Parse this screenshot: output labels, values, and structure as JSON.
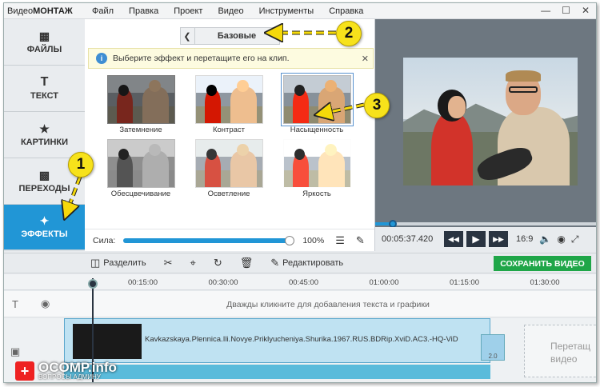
{
  "app": {
    "title_left": "Видео",
    "title_bold": "МОНТАЖ",
    "menu": [
      "Файл",
      "Правка",
      "Проект",
      "Видео",
      "Инструменты",
      "Справка"
    ]
  },
  "sidebar": {
    "items": [
      {
        "label": "ФАЙЛЫ",
        "icon": "image-icon"
      },
      {
        "label": "ТЕКСТ",
        "icon": "text-icon"
      },
      {
        "label": "КАРТИНКИ",
        "icon": "star-icon"
      },
      {
        "label": "ПЕРЕХОДЫ",
        "icon": "transition-icon"
      },
      {
        "label": "ЭФФЕКТЫ",
        "icon": "magic-wand-icon",
        "active": true
      }
    ]
  },
  "effects": {
    "category": "Базовые",
    "info_text": "Выберите эффект и перетащите его на клип.",
    "tiles": [
      {
        "label": "Затемнение",
        "style": "dark"
      },
      {
        "label": "Контраст",
        "style": "contrast"
      },
      {
        "label": "Насыщенность",
        "style": "saturation",
        "selected": true
      },
      {
        "label": "Обесцвечивание",
        "style": "gray"
      },
      {
        "label": "Осветление",
        "style": "light"
      },
      {
        "label": "Яркость",
        "style": "bright"
      }
    ],
    "power_label": "Сила:",
    "power_value": "100%",
    "power_fraction": 1.0
  },
  "player": {
    "time": "00:05:37.420",
    "aspect": "16:9",
    "progress_fraction": 0.08
  },
  "toolbar": {
    "split_label": "Разделить",
    "edit_label": "Редактировать",
    "save_label": "СОХРАНИТЬ ВИДЕО"
  },
  "timeline": {
    "ticks": [
      "00:15:00",
      "00:30:00",
      "00:45:00",
      "01:00:00",
      "01:15:00",
      "01:30:00"
    ],
    "text_track_hint": "Дважды кликните для добавления текста и графики",
    "clip_name": "Kavkazskaya.Plennica.Ili.Novye.Priklyucheniya.Shurika.1967.RUS.BDRip.XviD.AC3.-HQ-ViD",
    "clip_end_label": "2.0",
    "drop_zone_text": "Перетащ видео"
  },
  "watermark": {
    "icon": "+",
    "text": "OCOMP.info",
    "sub": "ВОПРОСЫ АДМИНУ"
  },
  "annotations": [
    "1",
    "2",
    "3"
  ]
}
